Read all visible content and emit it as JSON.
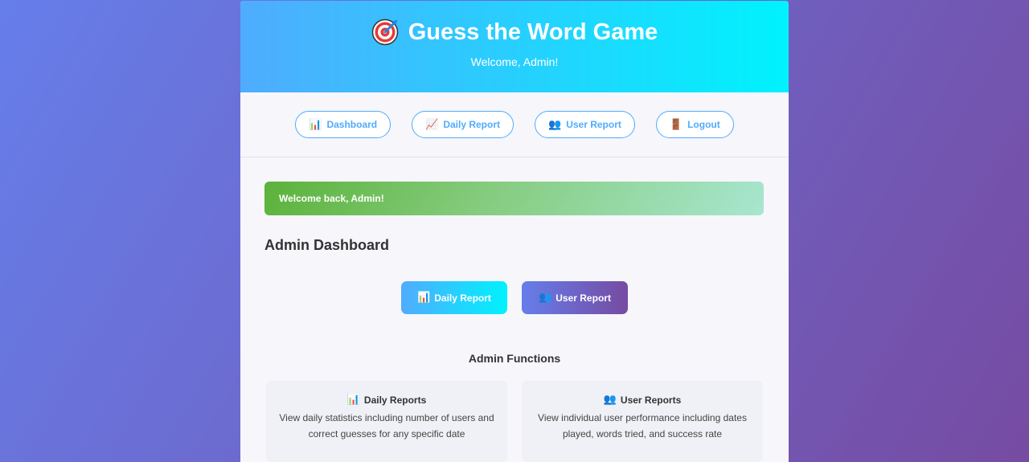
{
  "header": {
    "title": "Guess the Word Game",
    "subtitle": "Welcome, Admin!",
    "icon": "target-icon"
  },
  "nav": [
    {
      "icon": "📊",
      "label": "Dashboard"
    },
    {
      "icon": "📈",
      "label": "Daily Report"
    },
    {
      "icon": "👥",
      "label": "User Report"
    },
    {
      "icon": "🚪",
      "label": "Logout"
    }
  ],
  "alert": {
    "text": "Welcome back, Admin!"
  },
  "dashboard": {
    "heading": "Admin Dashboard"
  },
  "actions": [
    {
      "icon": "📊",
      "label": "Daily Report"
    },
    {
      "icon": "👥",
      "label": "User Report"
    }
  ],
  "functions": {
    "heading": "Admin Functions",
    "items": [
      {
        "icon": "📊",
        "title": "Daily Reports",
        "desc": "View daily statistics including number of users and correct guesses for any specific date"
      },
      {
        "icon": "👥",
        "title": "User Reports",
        "desc": "View individual user performance including dates played, words tried, and success rate"
      }
    ]
  },
  "colors": {
    "accent": "#4facfe",
    "header_gradient_end": "#00f2fe",
    "purple": "#667eea",
    "purple_dark": "#764ba2",
    "success": "#5bb23a"
  }
}
